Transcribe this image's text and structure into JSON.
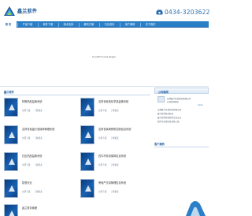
{
  "header": {
    "logo_text": "鑫兰软件",
    "logo_sub": "XINLAN SOFT",
    "phone": "0434-3203622"
  },
  "nav": {
    "items": [
      {
        "label": "首 页"
      },
      {
        "label": "产品介绍"
      },
      {
        "label": "软件下载"
      },
      {
        "label": "技术支持"
      },
      {
        "label": "解决方案"
      },
      {
        "label": "行业资讯"
      },
      {
        "label": "用户案例"
      },
      {
        "label": "关于我们"
      }
    ]
  },
  "banner": {
    "plugin_message": "Couldn't load plugin."
  },
  "products_section": {
    "title": "鑫兰软件",
    "download_label": "立即下载",
    "detail_label": "了解更多",
    "items": [
      {
        "name": "特殊药品监管系统"
      },
      {
        "name": "吉林省危险化学品监管系统"
      },
      {
        "name": "吉林省免疫计划接种管理系统"
      },
      {
        "name": "吉林省疾病预防控制信息系统"
      },
      {
        "name": "社区药品监管系统"
      },
      {
        "name": "四平市劳动保障信息系统"
      },
      {
        "name": "智慧农业"
      },
      {
        "name": "房地产交易管理信息系统"
      },
      {
        "name": "鑫兰财务管理"
      }
    ]
  },
  "sidebar": {
    "news_title": "公司新闻",
    "news_thumb_line1": "吉林鑫兰信息科技有限公司",
    "news_thumb_line2": "公司新闻资讯",
    "more_label": "more",
    "news": [
      {
        "text": "吉林鑫兰信息科技有限公司"
      },
      {
        "text": "鑫兰软件喜迁新址"
      },
      {
        "text": "鑫兰软件获得软件企业认证"
      },
      {
        "text": "四平市社保信息系统上线"
      }
    ],
    "cases_title": "客户案例"
  }
}
